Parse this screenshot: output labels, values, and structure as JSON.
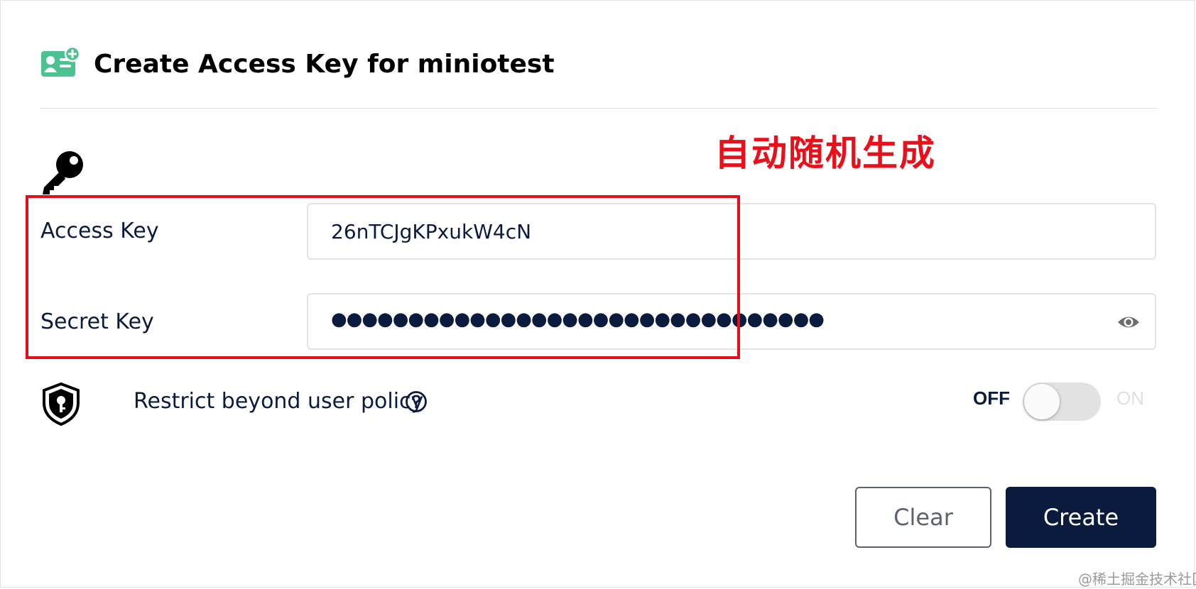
{
  "dialog": {
    "title": "Create Access Key for miniotest",
    "header_icon": "add-user-card-icon"
  },
  "annotation": {
    "text": "自动随机生成",
    "color": "#e8101a"
  },
  "fields": {
    "access_key": {
      "label": "Access Key",
      "value": "26nTCJgKPxukW4cN"
    },
    "secret_key": {
      "label": "Secret Key",
      "value": "●●●●●●●●●●●●●●●●●●●●●●●●●●●●●●●●",
      "icon": "eye-icon"
    }
  },
  "policy": {
    "label": "Restrict beyond user policy",
    "help_icon": "question-circle-icon",
    "shield_icon": "shield-key-icon",
    "toggle": {
      "off_label": "OFF",
      "on_label": "ON",
      "state": "off"
    }
  },
  "buttons": {
    "clear": "Clear",
    "create": "Create"
  },
  "colors": {
    "primary": "#0b1b3d",
    "accent_green": "#4cc191",
    "annotation_red": "#e3101c"
  },
  "watermark": "@稀土掘金技术社区"
}
